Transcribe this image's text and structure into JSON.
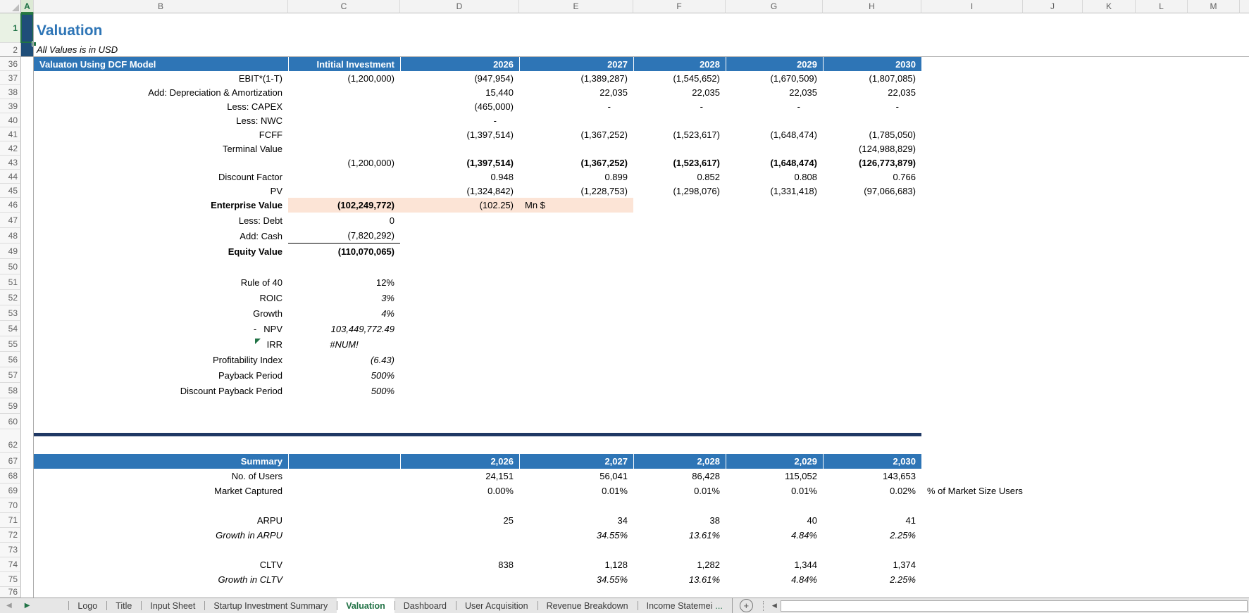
{
  "colors": {
    "accent_blue": "#2E75B6",
    "dark_navy_fill": "#1F4E79",
    "highlight_peach": "#FCE4D6",
    "separator_navy": "#1F3864",
    "active_tab_green": "#217346"
  },
  "grid": {
    "column_letters": [
      "A",
      "B",
      "C",
      "D",
      "E",
      "F",
      "G",
      "H",
      "I",
      "J",
      "K",
      "L",
      "M"
    ],
    "active_column": "A",
    "row_numbers": [
      1,
      2,
      36,
      37,
      38,
      39,
      40,
      41,
      42,
      43,
      44,
      45,
      46,
      47,
      48,
      49,
      50,
      51,
      52,
      53,
      54,
      55,
      56,
      57,
      58,
      59,
      60,
      62,
      67,
      68,
      69,
      70,
      71,
      72,
      73,
      74,
      75,
      76
    ],
    "active_row": 1
  },
  "sheet": {
    "title": "Valuation",
    "subtitle": "All Values is in USD"
  },
  "dcf_table": {
    "title": "Valuaton Using DCF Model",
    "col_c_header": "Intitial Investment",
    "year_headers": [
      "2026",
      "2027",
      "2028",
      "2029",
      "2030"
    ],
    "rows": [
      {
        "row": 37,
        "cells": {
          "b": "EBIT*(1-T)",
          "c": "(1,200,000)",
          "d": "(947,954)",
          "e": "(1,389,287)",
          "f": "(1,545,652)",
          "g": "(1,670,509)",
          "h": "(1,807,085)"
        }
      },
      {
        "row": 38,
        "cells": {
          "b": "Add: Depreciation & Amortization",
          "d": "15,440",
          "e": "22,035",
          "f": "22,035",
          "g": "22,035",
          "h": "22,035"
        }
      },
      {
        "row": 39,
        "cells": {
          "b": "Less: CAPEX",
          "d": "(465,000)",
          "e": "-",
          "f": "-",
          "g": "-",
          "h": "-"
        },
        "cls": {
          "e": "pad",
          "f": "pad",
          "g": "pad",
          "h": "pad"
        }
      },
      {
        "row": 40,
        "cells": {
          "b": "Less: NWC",
          "d": "-"
        },
        "cls": {
          "d": "pad"
        }
      },
      {
        "row": 41,
        "cells": {
          "b": "FCFF",
          "d": "(1,397,514)",
          "e": "(1,367,252)",
          "f": "(1,523,617)",
          "g": "(1,648,474)",
          "h": "(1,785,050)"
        }
      },
      {
        "row": 42,
        "cells": {
          "b": "Terminal Value",
          "h": "(124,988,829)"
        }
      },
      {
        "row": 43,
        "cells": {
          "c": "(1,200,000)",
          "d": "(1,397,514)",
          "e": "(1,367,252)",
          "f": "(1,523,617)",
          "g": "(1,648,474)",
          "h": "(126,773,879)"
        },
        "cls": {
          "d": "bold",
          "e": "bold",
          "f": "bold",
          "g": "bold",
          "h": "bold"
        }
      },
      {
        "row": 44,
        "cells": {
          "b": "Discount Factor",
          "d": "0.948",
          "e": "0.899",
          "f": "0.852",
          "g": "0.808",
          "h": "0.766"
        }
      },
      {
        "row": 45,
        "cells": {
          "b": "PV",
          "d": "(1,324,842)",
          "e": "(1,228,753)",
          "f": "(1,298,076)",
          "g": "(1,331,418)",
          "h": "(97,066,683)"
        }
      },
      {
        "row": 46,
        "highlight": true,
        "cells": {
          "b": "Enterprise Value",
          "c": "(102,249,772)",
          "d": "(102.25)",
          "e": "Mn $"
        },
        "cls": {
          "b": "bold",
          "c": "bold",
          "e": "left"
        }
      },
      {
        "row": 47,
        "cells": {
          "b": "Less: Debt",
          "c": "0"
        }
      },
      {
        "row": 48,
        "cells": {
          "b": "Add: Cash",
          "c": "(7,820,292)"
        },
        "cls": {
          "c": "underline"
        }
      },
      {
        "row": 49,
        "cells": {
          "b": "Equity Value",
          "c": "(110,070,065)"
        },
        "cls": {
          "b": "bold",
          "c": "bold"
        }
      },
      {
        "row": 51,
        "cells": {
          "b": "Rule of 40",
          "c": "12%"
        }
      },
      {
        "row": 52,
        "cells": {
          "b": "ROIC",
          "c": "3%"
        },
        "cls": {
          "c": "italic"
        }
      },
      {
        "row": 53,
        "cells": {
          "b": "Growth",
          "c": "4%"
        },
        "cls": {
          "c": "italic"
        }
      },
      {
        "row": 54,
        "cells": {
          "b": "NPV",
          "dash": "-",
          "c": "103,449,772.49"
        },
        "cls": {
          "c": "italic",
          "dash": "center"
        }
      },
      {
        "row": 55,
        "error_flag": true,
        "cells": {
          "b": "IRR",
          "c": "#NUM!"
        },
        "cls": {
          "c": "italic center"
        }
      },
      {
        "row": 56,
        "cells": {
          "b": "Profitability Index",
          "c": "(6.43)"
        },
        "cls": {
          "c": "italic"
        }
      },
      {
        "row": 57,
        "cells": {
          "b": "Payback Period",
          "c": "500%"
        },
        "cls": {
          "c": "italic"
        }
      },
      {
        "row": 58,
        "cells": {
          "b": "Discount Payback Period",
          "c": "500%"
        },
        "cls": {
          "c": "italic"
        }
      }
    ]
  },
  "summary_table": {
    "title": "Summary",
    "year_headers": [
      "2,026",
      "2,027",
      "2,028",
      "2,029",
      "2,030"
    ],
    "rows": [
      {
        "row": 68,
        "cells": {
          "b": "No. of Users",
          "d": "24,151",
          "e": "56,041",
          "f": "86,428",
          "g": "115,052",
          "h": "143,653"
        }
      },
      {
        "row": 69,
        "cells": {
          "b": "Market Captured",
          "d": "0.00%",
          "e": "0.01%",
          "f": "0.01%",
          "g": "0.01%",
          "h": "0.02%",
          "i": "% of Market Size Users"
        },
        "cls": {
          "i": "left wide"
        }
      },
      {
        "row": 71,
        "cells": {
          "b": "ARPU",
          "d": "25",
          "e": "34",
          "f": "38",
          "g": "40",
          "h": "41"
        }
      },
      {
        "row": 72,
        "cells": {
          "b": "Growth in ARPU",
          "e": "34.55%",
          "f": "13.61%",
          "g": "4.84%",
          "h": "2.25%"
        },
        "cls": {
          "b": "italic",
          "e": "italic",
          "f": "italic",
          "g": "italic",
          "h": "italic"
        }
      },
      {
        "row": 74,
        "cells": {
          "b": "CLTV",
          "d": "838",
          "e": "1,128",
          "f": "1,282",
          "g": "1,344",
          "h": "1,374"
        }
      },
      {
        "row": 75,
        "cells": {
          "b": "Growth in CLTV",
          "e": "34.55%",
          "f": "13.61%",
          "g": "4.84%",
          "h": "2.25%"
        },
        "cls": {
          "b": "italic",
          "e": "italic",
          "f": "italic",
          "g": "italic",
          "h": "italic"
        }
      }
    ]
  },
  "tabbar": {
    "prev_sheet_icon": "left-triangle",
    "next_sheet_icon": "right-triangle",
    "tabs": [
      {
        "label": "Logo"
      },
      {
        "label": "Title"
      },
      {
        "label": "Input Sheet"
      },
      {
        "label": "Startup Investment Summary"
      },
      {
        "label": "Valuation",
        "active": true
      },
      {
        "label": "Dashboard"
      },
      {
        "label": "User Acquisition"
      },
      {
        "label": "Revenue Breakdown"
      },
      {
        "label": "Income Statemei",
        "ellipsis": "..."
      }
    ],
    "add_sheet_label": "+",
    "scroll_left_icon": "left-triangle"
  }
}
